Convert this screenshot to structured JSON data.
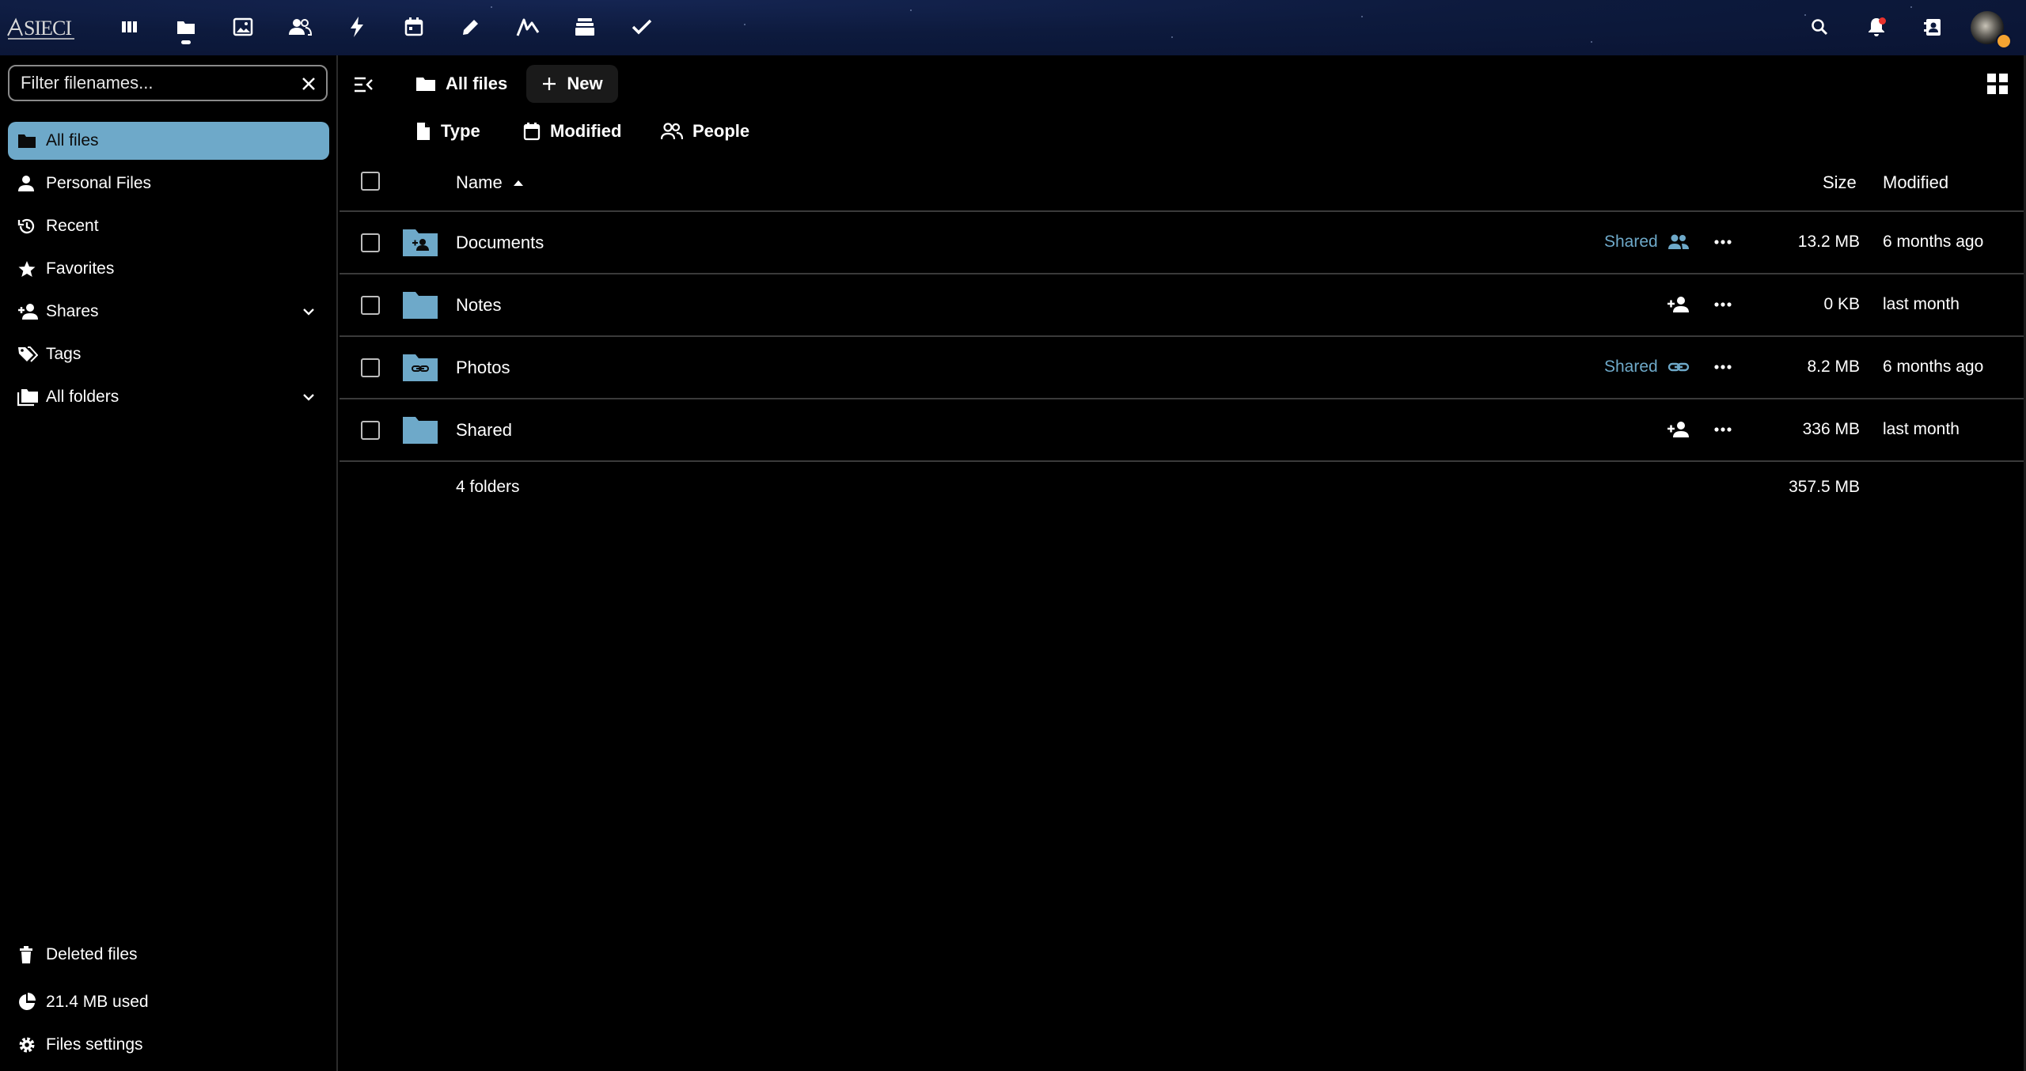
{
  "header": {
    "logo_text": "SIECI",
    "apps": [
      {
        "name": "dashboard-icon",
        "label": "Dashboard"
      },
      {
        "name": "files-icon",
        "label": "Files",
        "active": true
      },
      {
        "name": "photos-icon",
        "label": "Photos"
      },
      {
        "name": "contacts-icon",
        "label": "Contacts"
      },
      {
        "name": "activity-icon",
        "label": "Activity"
      },
      {
        "name": "calendar-icon",
        "label": "Calendar"
      },
      {
        "name": "notes-icon",
        "label": "Notes"
      },
      {
        "name": "analytics-icon",
        "label": "Analytics"
      },
      {
        "name": "deck-icon",
        "label": "Deck"
      },
      {
        "name": "tasks-icon",
        "label": "Tasks"
      }
    ],
    "right_icons": [
      "search-icon",
      "notifications-icon",
      "contacts-menu-icon"
    ]
  },
  "sidebar": {
    "filter_placeholder": "Filter filenames...",
    "items": [
      {
        "label": "All files",
        "icon": "folder-icon",
        "active": true
      },
      {
        "label": "Personal Files",
        "icon": "person-icon"
      },
      {
        "label": "Recent",
        "icon": "history-icon"
      },
      {
        "label": "Favorites",
        "icon": "star-icon"
      },
      {
        "label": "Shares",
        "icon": "share-icon",
        "expandable": true
      },
      {
        "label": "Tags",
        "icon": "tag-icon"
      },
      {
        "label": "All folders",
        "icon": "folders-icon",
        "expandable": true
      }
    ],
    "footer": {
      "deleted": "Deleted files",
      "quota": "21.4 MB used",
      "settings": "Files settings"
    }
  },
  "main": {
    "breadcrumb": "All files",
    "new_label": "New",
    "filters": {
      "type": "Type",
      "modified": "Modified",
      "people": "People"
    },
    "columns": {
      "name": "Name",
      "size": "Size",
      "modified": "Modified"
    },
    "rows": [
      {
        "name": "Documents",
        "shared_label": "Shared",
        "share_icon": "shared-group-icon",
        "size": "13.2 MB",
        "modified": "6 months ago"
      },
      {
        "name": "Notes",
        "shared_label": "",
        "share_icon": "share-add-icon",
        "size": "0 KB",
        "modified": "last month"
      },
      {
        "name": "Photos",
        "shared_label": "Shared",
        "share_icon": "link-icon",
        "size": "8.2 MB",
        "modified": "6 months ago"
      },
      {
        "name": "Shared",
        "shared_label": "",
        "share_icon": "share-add-icon",
        "size": "336 MB",
        "modified": "last month"
      }
    ],
    "summary": {
      "count": "4 folders",
      "total": "357.5 MB"
    }
  },
  "colors": {
    "accent": "#6ea9c9",
    "header_bg": "#0d1a3d",
    "background": "#000000"
  }
}
